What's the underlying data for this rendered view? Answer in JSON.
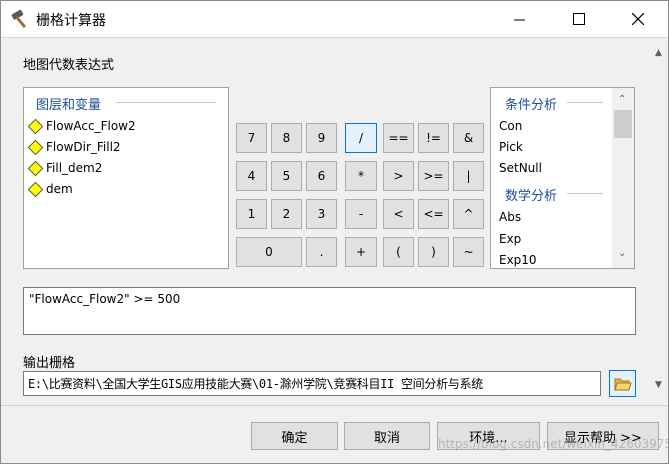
{
  "window": {
    "title": "栅格计算器"
  },
  "map_algebra_label": "地图代数表达式",
  "layers": {
    "header": "图层和变量",
    "items": [
      "FlowAcc_Flow2",
      "FlowDir_Fill2",
      "Fill_dem2",
      "dem"
    ]
  },
  "keypad": [
    [
      "7",
      "8",
      "9",
      "/",
      "==",
      "!=",
      "&"
    ],
    [
      "4",
      "5",
      "6",
      "*",
      ">",
      ">=",
      "|"
    ],
    [
      "1",
      "2",
      "3",
      "-",
      "<",
      "<=",
      "^"
    ],
    [
      "0",
      ".",
      "+",
      "(",
      ")",
      "~"
    ]
  ],
  "functions": {
    "conditional_header": "条件分析",
    "conditional": [
      "Con",
      "Pick",
      "SetNull"
    ],
    "math_header": "数学分析",
    "math": [
      "Abs",
      "Exp",
      "Exp10"
    ]
  },
  "expression": "\"FlowAcc_Flow2\" >= 500",
  "output": {
    "label": "输出栅格",
    "value": "E:\\比赛资料\\全国大学生GIS应用技能大赛\\01-滁州学院\\竞赛科目II 空间分析与系统"
  },
  "buttons": {
    "ok": "确定",
    "cancel": "取消",
    "env": "环境...",
    "help": "显示帮助 >>"
  },
  "watermark": "https://blog.csdn.net/weixin_42603975"
}
